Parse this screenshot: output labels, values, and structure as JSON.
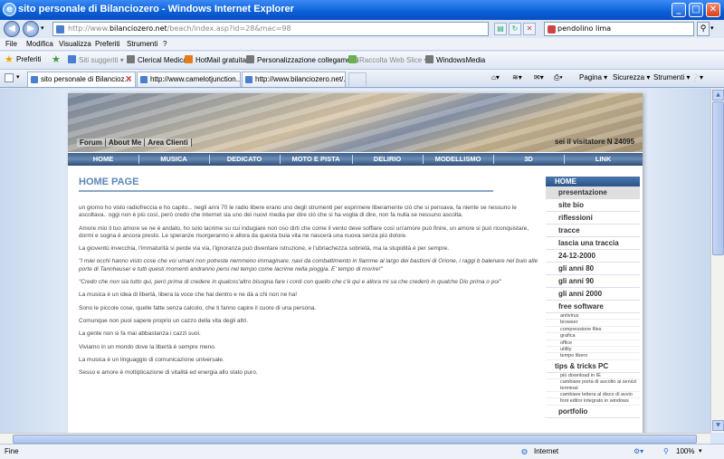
{
  "window": {
    "title": "sito personale di Bilanciozero - Windows Internet Explorer",
    "minimize": "_",
    "maximize": "□",
    "close": "✕"
  },
  "address": {
    "url_prefix": "http://www.",
    "url_host": "bilanciozero.net",
    "url_rest": "/beach/index.asp?id=28&mac=98"
  },
  "search": {
    "value": "pendolino lima"
  },
  "menu": [
    "File",
    "Modifica",
    "Visualizza",
    "Preferiti",
    "Strumenti",
    "?"
  ],
  "favorites": {
    "label": "Preferiti",
    "items": [
      "Siti suggeriti ▾",
      "Clerical Medical",
      "HotMail gratuita",
      "Personalizzazione collegamenti",
      "Raccolta Web Slice ▾",
      "WindowsMedia"
    ]
  },
  "tabs": [
    {
      "label": "sito personale di Bilancioz..."
    },
    {
      "label": "http://www.camelotjunction...."
    },
    {
      "label": "http://www.bilanciozero.net/..."
    }
  ],
  "toolbar": {
    "page": "Pagina ▾",
    "security": "Sicurezza ▾",
    "tools": "Strumenti ▾",
    "help": "❔▾"
  },
  "site": {
    "top_links": [
      "Forum",
      "About Me",
      "Area Clienti"
    ],
    "visitors": "sei il visitatore N 24095",
    "nav": [
      "HOME",
      "MUSICA",
      "DEDICATO",
      "MOTO E PISTA",
      "DELIRIO",
      "MODELLISMO",
      "3D",
      "LINK"
    ],
    "page_title": "HOME PAGE",
    "paragraphs": [
      "un giorno ho visto radiofreccia e ho capito... negli anni 70 le radio libere erano uno degli strumenti per esprimere liberamente ciò che si pensava, fa niente se nessuno le ascoltava.. oggi non è più così, però credo che internet sia uno dei nuovi media per dire ciò che si ha voglia di dire, non fa nulla se nessuno ascolta.",
      "Amore mio il tuo amore se ne è andato, ho solo lacrime su cui indugiare non oso dirti che come il vento deve soffiare così un'amore può finire, un amore si può riconquistare, dormi e sogna è ancora presto. Le speranze risorgeranno e allora da questa buia vita ne nascerà una nuova senza più dolore.",
      "La gioventù invecchia, l'immaturità si perde via via, l'ignoranza può diventare istruzione, e l'ubriachezza sobrietà, ma la stupidità è per sempre.",
      "\"I miei occhi hanno visto cose che voi umani non potreste nemmeno immaginare; navi da combattimento in fiamme al largo dei bastioni di Orione, i raggi b balenare nel buio alle porte di Tannheuser e tutti questi momenti andranno persi nel tempo come lacrime nella pioggia. E' tempo di morire!\"",
      "\"Credo che non sia tutto qui, però prima di credere in qualcos'altro bisogna fare i conti con quello che c'è qui e allora mi sa che crederò in qualche Dio prima o poi\"",
      "La musica è un idea di libertà, libera la voce che hai dentro e ne dà a chi non ne ha!",
      "Sono le piccole cose, quelle fatte senza calcolo, che ti fanno capire il cuore di una persona.",
      "Comunque non puoi sapere proprio un cazzo della vita degli altri.",
      "La gente non si fa mai abbastanza i cazzi suoi.",
      "Viviamo in un mondo dove la libertà è sempre meno.",
      "La musica è un linguaggio di comunicazione universale.",
      "Sesso e amore è moltiplicazione di vitalità ed energia allo stato puro."
    ],
    "sidebar": {
      "head": "HOME",
      "items_a": [
        "presentazione",
        "site bio",
        "riflessioni",
        "tracce",
        "lascia una traccia",
        "24-12-2000",
        "gli anni 80",
        "gli anni 90",
        "gli anni 2000",
        "free software"
      ],
      "free_software_sub": [
        "antivirus",
        "browser",
        "compressione files",
        "grafica",
        "office",
        "utility",
        "tempo libero"
      ],
      "tips_label": "tips & tricks PC",
      "tips_sub": [
        "più download in IE",
        "cambiare porta di ascolto ai servizi terminal",
        "cambiare lettera al disco di avvio",
        "font editor integrato in windows"
      ],
      "last_item": "portfolio"
    }
  },
  "status": {
    "left": "Fine",
    "zone": "Internet",
    "zoom": "100%"
  }
}
